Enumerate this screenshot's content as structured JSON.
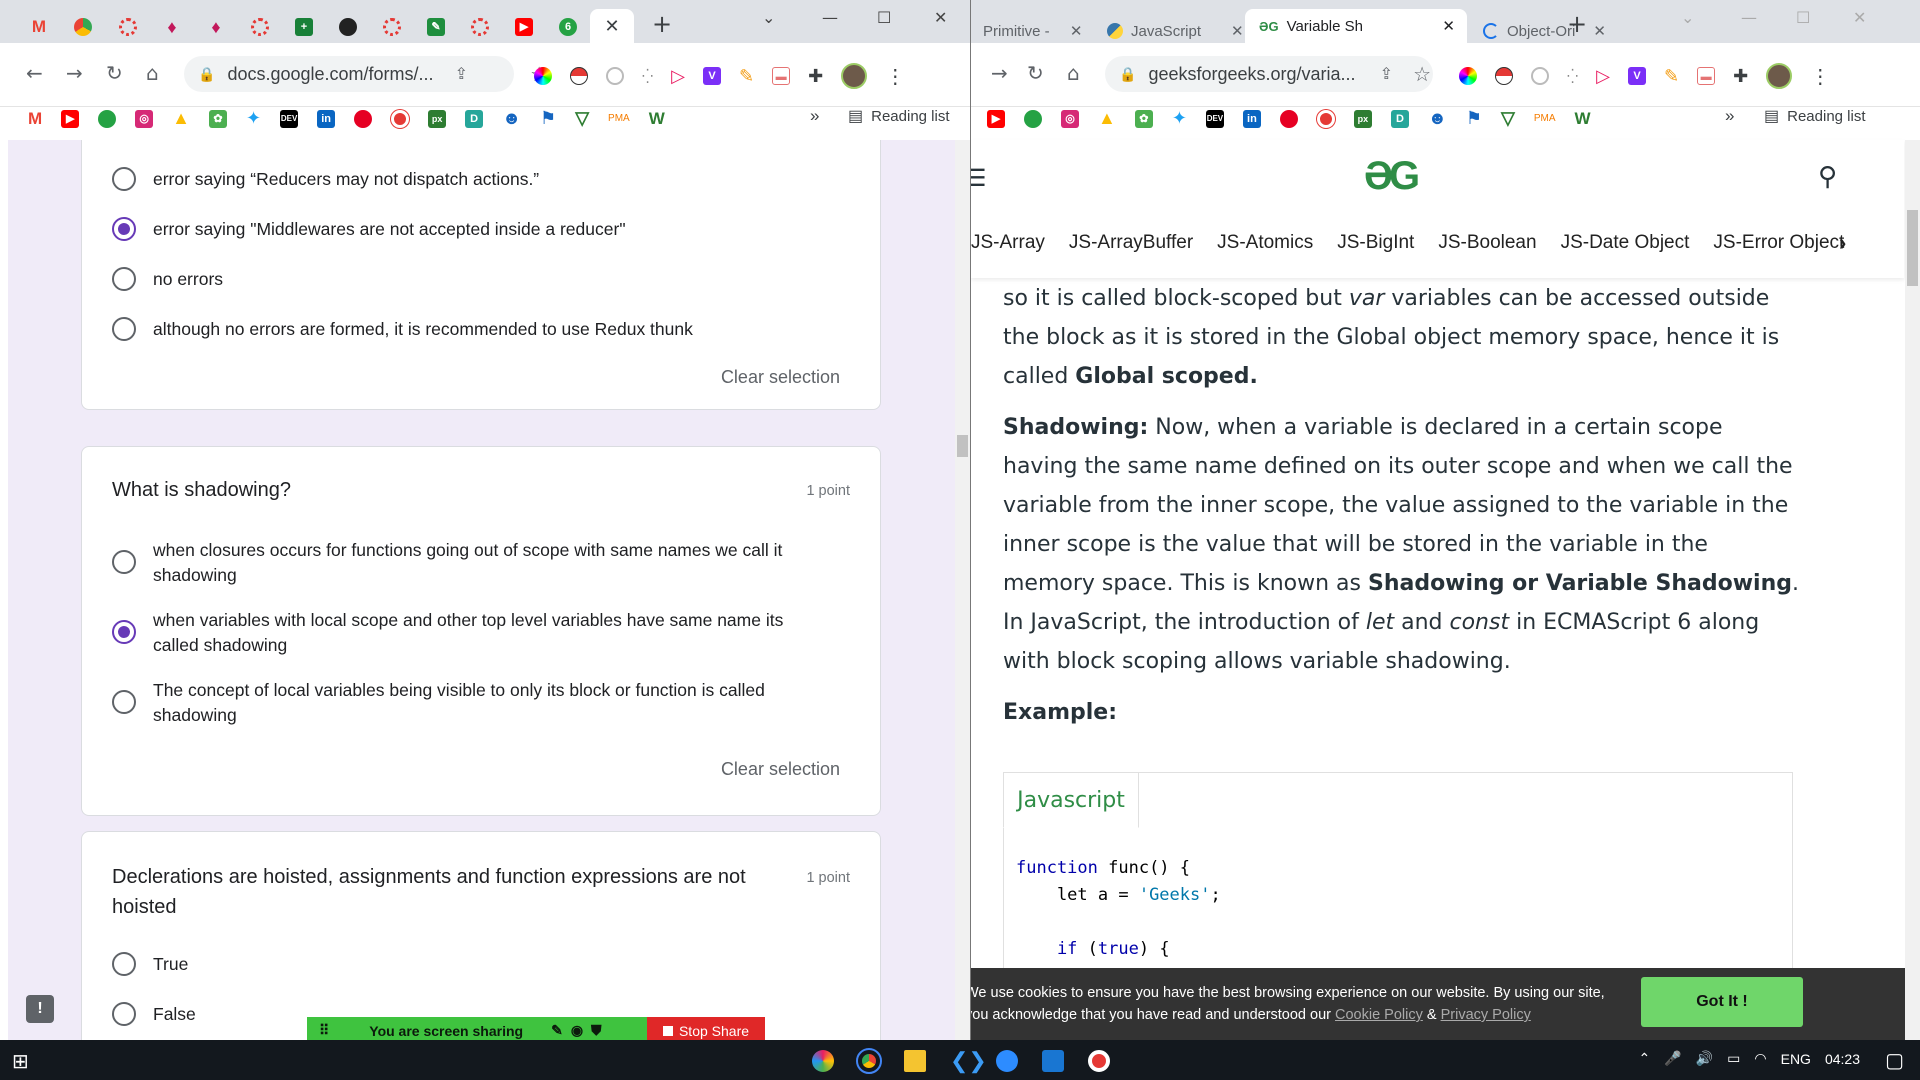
{
  "left_window": {
    "tabs": [
      {
        "icon": "gmail-icon",
        "color": "#ea4335"
      },
      {
        "icon": "maps-icon",
        "color": "#34a853"
      },
      {
        "icon": "wheel-icon",
        "color": "#e53935"
      },
      {
        "icon": "pin-icon",
        "color": "#c2185b"
      },
      {
        "icon": "pin-icon",
        "color": "#c2185b"
      },
      {
        "icon": "wheel-icon",
        "color": "#e53935"
      },
      {
        "icon": "sheets-icon",
        "color": "#188038"
      },
      {
        "icon": "github-icon",
        "color": "#222222"
      },
      {
        "icon": "wheel-icon",
        "color": "#e53935"
      },
      {
        "icon": "grammar-icon",
        "color": "#1e8e3e"
      },
      {
        "icon": "wheel-icon",
        "color": "#e53935"
      },
      {
        "icon": "youtube-icon",
        "color": "#ff0000"
      },
      {
        "icon": "six-icon",
        "color": "#25a244"
      }
    ],
    "url": "docs.google.com/forms/...",
    "reading_list": "Reading list",
    "more_bookmarks": "»",
    "close_tab": "✕",
    "new_tab": "+"
  },
  "right_window": {
    "tabs": [
      {
        "label": "Primitive -",
        "active": false
      },
      {
        "label": "JavaScript",
        "active": false
      },
      {
        "label": "Variable Sh",
        "active": true
      },
      {
        "label": "Object-Ori",
        "active": false
      }
    ],
    "url": "geeksforgeeks.org/varia...",
    "reading_list": "Reading list",
    "more_bookmarks": "»",
    "new_tab": "+"
  },
  "form": {
    "q1": {
      "options": [
        {
          "label": "error saying “Reducers may not dispatch actions.”",
          "selected": false
        },
        {
          "label": "error saying \"Middlewares are not accepted inside a reducer\"",
          "selected": true
        },
        {
          "label": "no errors",
          "selected": false
        },
        {
          "label": "although no errors are formed, it is recommended to use Redux thunk",
          "selected": false
        }
      ],
      "clear": "Clear selection"
    },
    "q2": {
      "title": "What is shadowing?",
      "points": "1 point",
      "options": [
        {
          "label": "when closures occurs for functions going out of scope with same names we call it shadowing",
          "selected": false
        },
        {
          "label": "when variables with local scope and other top level variables have same name its called shadowing",
          "selected": true
        },
        {
          "label": "The concept of local variables being visible to only its block or function is called shadowing",
          "selected": false
        }
      ],
      "clear": "Clear selection"
    },
    "q3": {
      "title": "Declerations are hoisted, assignments and function expressions are not hoisted",
      "points": "1 point",
      "options": [
        {
          "label": "True",
          "selected": false
        },
        {
          "label": "False",
          "selected": false
        }
      ]
    }
  },
  "screen_share": {
    "status": "You are screen sharing",
    "stop": "Stop Share"
  },
  "gfg": {
    "logo": "ƏG",
    "nav": [
      "JS-Array",
      "JS-ArrayBuffer",
      "JS-Atomics",
      "JS-BigInt",
      "JS-Boolean",
      "JS-Date Object",
      "JS-Error Object"
    ],
    "para1_a": "so it is called block-scoped but ",
    "para1_var": "var",
    "para1_b": " variables can be accessed outside the block as it is stored in the Global object memory space, hence it is called ",
    "para1_bold": "Global scoped.",
    "para2_label": "Shadowing:",
    "para2_a": " Now, when a variable is declared in a certain scope having the same name defined on its outer scope and when we call the variable from the inner scope, the value assigned to the variable in the inner scope is the value that will be stored in the variable in the memory space. This is known as ",
    "para2_bold": "Shadowing or Variable Shadowing",
    "para2_b": ". In JavaScript, the introduction of ",
    "para2_let": "let",
    "para2_c": " and ",
    "para2_const": "const",
    "para2_d": " in ECMAScript 6 along with block scoping allows variable shadowing.",
    "example": "Example:",
    "code_tab": "Javascript",
    "code": {
      "l1_kw": "function",
      "l1_rest": " func() {",
      "l2_a": "    let a = ",
      "l2_str": "'Geeks'",
      "l2_b": ";",
      "l4_kw": "    if",
      "l4_a": " (",
      "l4_kw2": "true",
      "l4_b": ") {"
    },
    "cookie_a": "We use cookies to ensure you have the best browsing experience on our website. By using our site, you acknowledge that you have read and understood our ",
    "cookie_link1": "Cookie Policy",
    "cookie_amp": " & ",
    "cookie_link2": "Privacy Policy",
    "got_it": "Got It !"
  },
  "taskbar": {
    "lang": "ENG",
    "time": "04:23"
  }
}
